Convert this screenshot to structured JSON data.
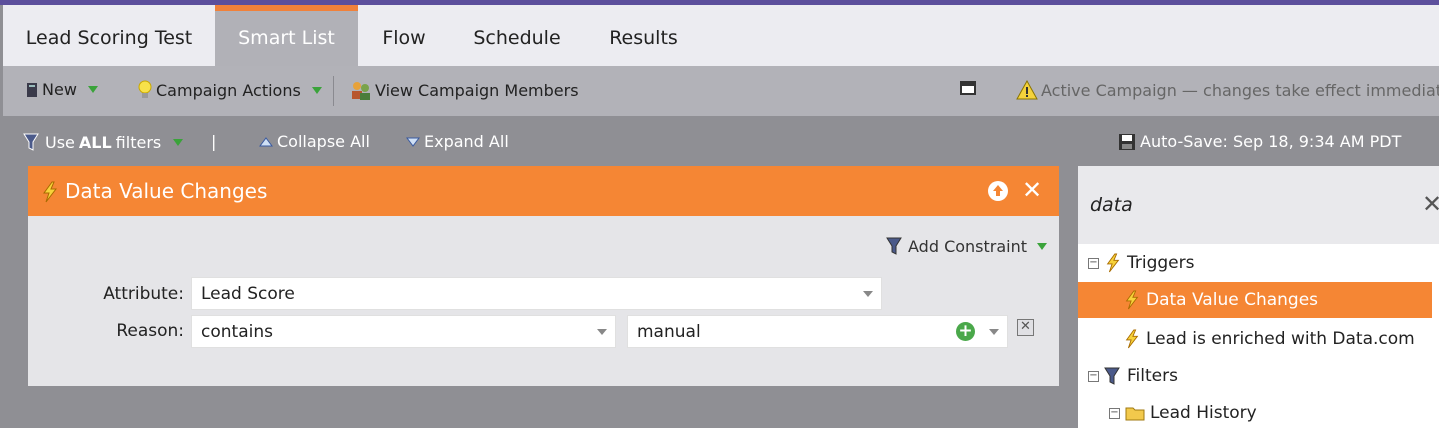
{
  "tabs": [
    {
      "label": "Lead Scoring Test"
    },
    {
      "label": "Smart List",
      "active": true
    },
    {
      "label": "Flow"
    },
    {
      "label": "Schedule"
    },
    {
      "label": "Results"
    }
  ],
  "toolbar": {
    "new_label": "New",
    "campaign_actions_label": "Campaign Actions",
    "view_members_label": "View Campaign Members",
    "warning_text": "Active Campaign — changes take effect immediately"
  },
  "filterbar": {
    "use_prefix": "Use",
    "use_all": "ALL",
    "use_suffix": "filters",
    "divider": "|",
    "collapse_label": "Collapse All",
    "expand_label": "Expand All",
    "autosave_label": "Auto-Save: Sep 18, 9:34 AM PDT"
  },
  "trigger_card": {
    "title": "Data Value Changes",
    "add_constraint_label": "Add Constraint",
    "attribute_label": "Attribute:",
    "attribute_value": "Lead Score",
    "reason_label": "Reason:",
    "reason_operator": "contains",
    "reason_value": "manual"
  },
  "panel": {
    "search_value": "data",
    "triggers_label": "Triggers",
    "trigger_items": [
      "Data Value Changes",
      "Lead is enriched with Data.com"
    ],
    "filters_label": "Filters",
    "lead_history_label": "Lead History"
  },
  "colors": {
    "accent_orange": "#f58634",
    "top_purple": "#5c4f9c",
    "add_green": "#4aa84a"
  }
}
